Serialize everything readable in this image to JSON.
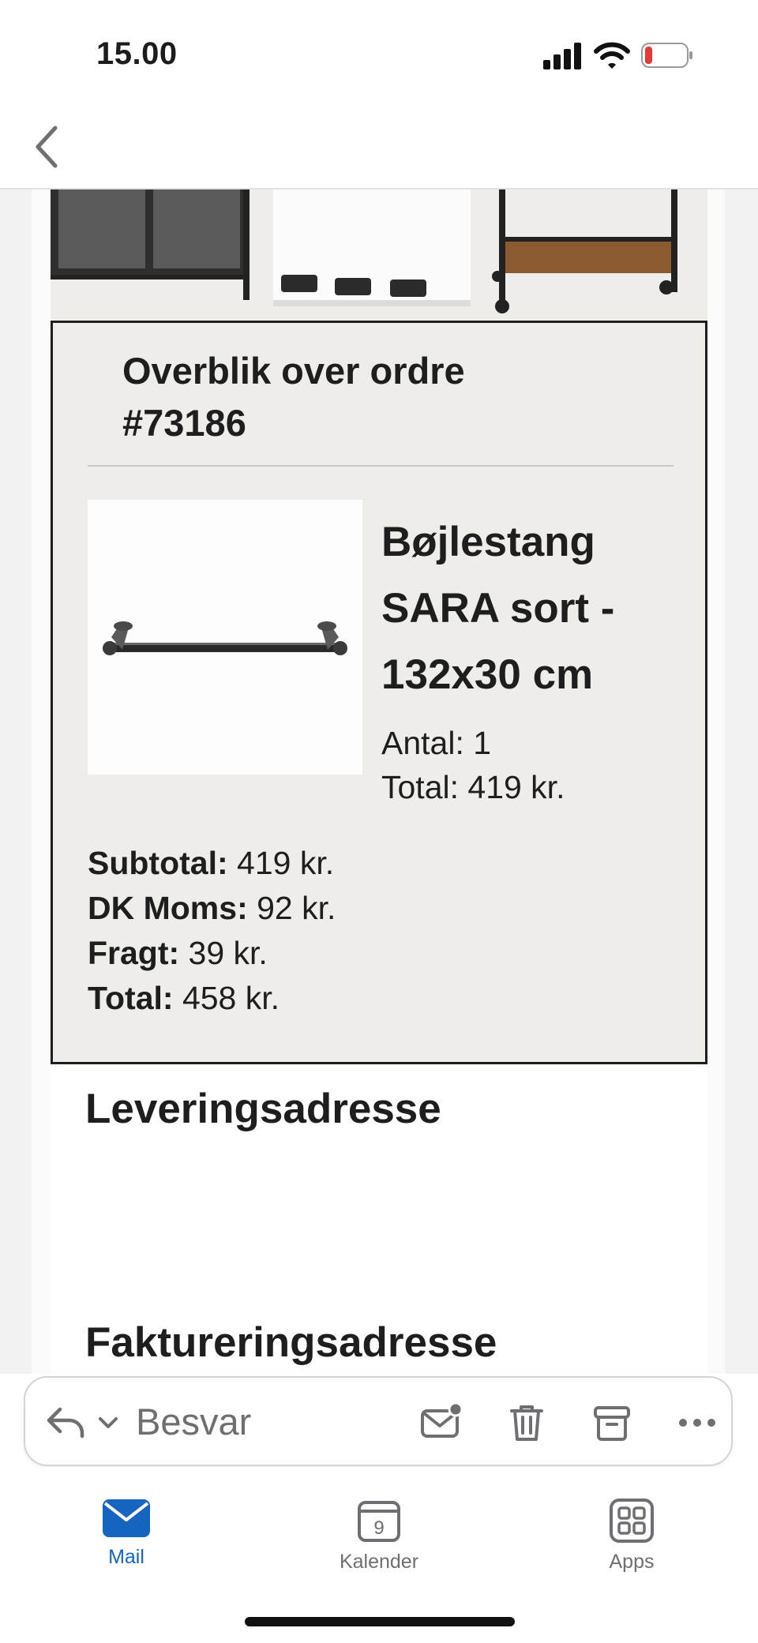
{
  "status_bar": {
    "time": "15.00"
  },
  "email": {
    "order_title": "Overblik over ordre #73186",
    "product": {
      "name": "Bøjlestang SARA sort - 132x30 cm",
      "quantity": "Antal: 1",
      "total": "Total: 419 kr."
    },
    "totals": [
      {
        "label": "Subtotal:",
        "value": " 419 kr."
      },
      {
        "label": "DK Moms:",
        "value": " 92 kr."
      },
      {
        "label": "Fragt:",
        "value": " 39 kr."
      },
      {
        "label": "Total:",
        "value": " 458 kr."
      }
    ],
    "delivery_heading": "Leveringsadresse",
    "billing_heading": "Faktureringsadresse"
  },
  "toolbar": {
    "reply_label": "Besvar",
    "icons": [
      "reply-icon",
      "chevron-down-icon",
      "mark-unread-icon",
      "trash-icon",
      "archive-icon",
      "more-icon"
    ]
  },
  "tabs": [
    {
      "label": "Mail",
      "icon": "mail-icon",
      "active": true
    },
    {
      "label": "Kalender",
      "icon": "calendar-icon",
      "badge": "9",
      "active": false
    },
    {
      "label": "Apps",
      "icon": "apps-icon",
      "active": false
    }
  ],
  "colors": {
    "accent": "#1565c0",
    "battery_low": "#e53935",
    "order_box_bg": "#eeede9"
  }
}
